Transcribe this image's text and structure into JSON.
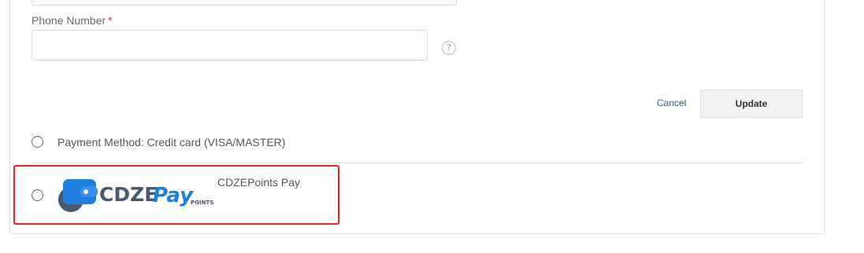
{
  "form": {
    "phone_label": "Phone Number",
    "required_marker": "*",
    "phone_value": "",
    "help_glyph": "?",
    "cancel_label": "Cancel",
    "update_label": "Update"
  },
  "payment_methods": [
    {
      "label": "Payment Method: Credit card (VISA/MASTER)",
      "selected": false
    },
    {
      "label": "CDZEPoints Pay",
      "selected": false,
      "logo": {
        "text_dark": "CDZE",
        "text_blue": "Pay",
        "subtext": "POINTS."
      }
    }
  ],
  "colors": {
    "highlight_border": "#e0281f",
    "logo_dark": "#4a5a6e",
    "logo_blue": "#1e7fe0",
    "link": "#2d5d8c",
    "required": "#e02b27"
  }
}
